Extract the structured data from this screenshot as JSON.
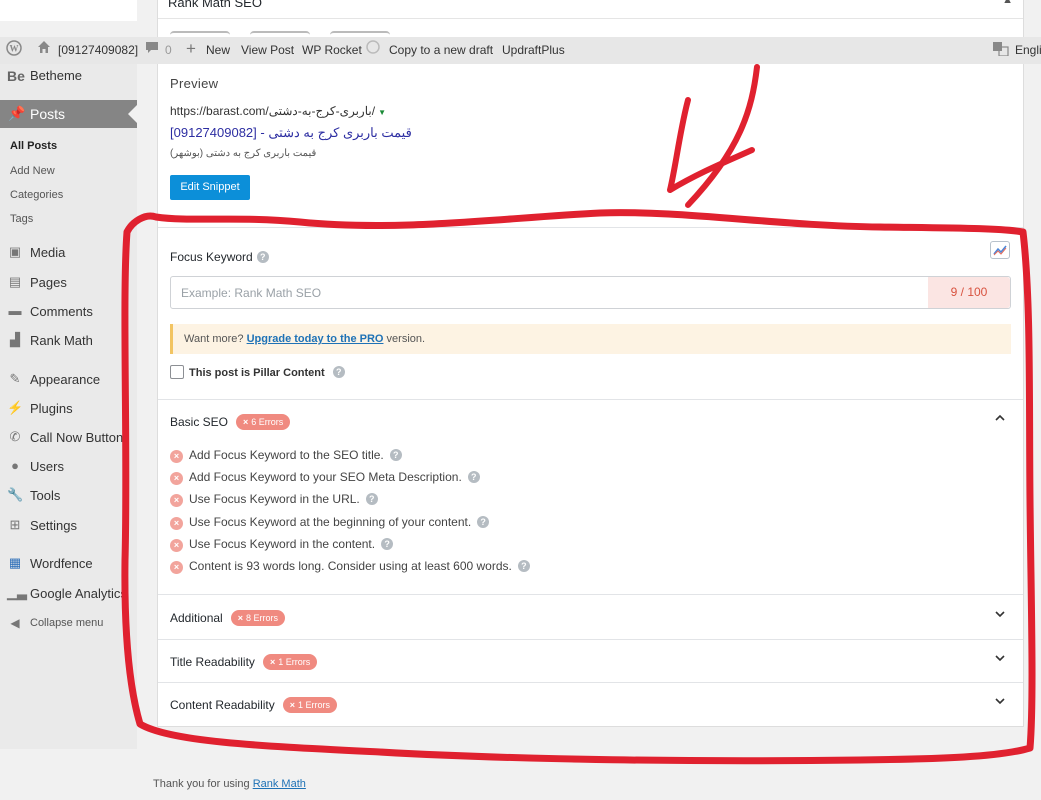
{
  "metabox": {
    "title": "Rank Math SEO"
  },
  "adminbar": {
    "site_label": "[09127409082]",
    "comments_count": "0",
    "new_label": "New",
    "view_post": "View Post",
    "wp_rocket": "WP Rocket",
    "copy_draft": "Copy to a new draft",
    "updraft": "UpdraftPlus",
    "language": "Engli"
  },
  "sidebar": {
    "site_short": "Be",
    "site_name": "Betheme",
    "posts_label": "Posts",
    "submenu": [
      "All Posts",
      "Add New",
      "Categories",
      "Tags"
    ],
    "items": [
      "Media",
      "Pages",
      "Comments",
      "Rank Math",
      "Appearance",
      "Plugins",
      "Call Now Button",
      "Users",
      "Tools",
      "Settings",
      "Wordfence",
      "Google Analytics",
      "Collapse menu"
    ]
  },
  "preview": {
    "label": "Preview",
    "url": "https://barast.com/باربری-کرج-به-دشتی/",
    "title": "قیمت باربری کرج به دشتی - [09127409082]",
    "description": "قیمت باربری کرج به دشتی (بوشهر)",
    "edit_button": "Edit Snippet"
  },
  "focus_keyword": {
    "label": "Focus Keyword",
    "placeholder": "Example: Rank Math SEO",
    "value": "",
    "count": "9 / 100"
  },
  "notice": {
    "prefix": "Want more?",
    "link": "Upgrade today to the PRO",
    "suffix": "version."
  },
  "pillar": {
    "label": "This post is Pillar Content"
  },
  "sections": {
    "basic": {
      "title": "Basic SEO",
      "badge": "6 Errors"
    },
    "additional": {
      "title": "Additional",
      "badge": "8 Errors"
    },
    "title_readability": {
      "title": "Title Readability",
      "badge": "1 Errors"
    },
    "content_readability": {
      "title": "Content Readability",
      "badge": "1 Errors"
    }
  },
  "basic_errors": [
    "Add Focus Keyword to the SEO title.",
    "Add Focus Keyword to your SEO Meta Description.",
    "Use Focus Keyword in the URL.",
    "Use Focus Keyword at the beginning of your content.",
    "Use Focus Keyword in the content.",
    "Content is 93 words long. Consider using at least 600 words."
  ],
  "footer": {
    "prefix": "Thank you for using",
    "link": "Rank Math"
  },
  "colors": {
    "error_badge": "#f08a80",
    "primary_button": "#0c8fd9",
    "annotation_red": "#e0212f",
    "notice_border": "#f2c462"
  }
}
